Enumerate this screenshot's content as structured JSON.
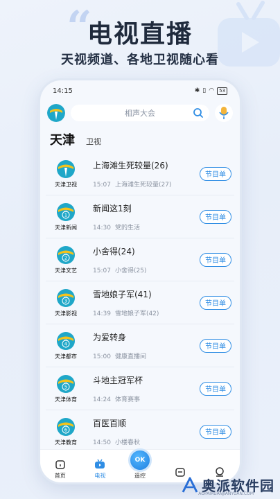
{
  "promo": {
    "title": "电视直播",
    "subtitle": "天视频道、各地卫视随心看"
  },
  "status_bar": {
    "time": "14:15",
    "icons": [
      "bluetooth-icon",
      "vibrate-icon",
      "wifi-icon",
      "battery-icon"
    ],
    "battery": "53"
  },
  "search": {
    "placeholder": "相声大会"
  },
  "categories": {
    "active": "天津",
    "secondary": "卫视"
  },
  "channels": [
    {
      "name": "天津卫视",
      "num": "",
      "now": "上海滩生死较量(26)",
      "next_time": "15:07",
      "next_title": "上海滩生死较量(27)",
      "button": "节目单"
    },
    {
      "name": "天津新闻",
      "num": "1",
      "now": "新闻这1刻",
      "next_time": "14:30",
      "next_title": "党的生活",
      "button": "节目单"
    },
    {
      "name": "天津文艺",
      "num": "2",
      "now": "小舍得(24)",
      "next_time": "15:07",
      "next_title": "小舍得(25)",
      "button": "节目单"
    },
    {
      "name": "天津影视",
      "num": "3",
      "now": "雪地娘子军(41)",
      "next_time": "14:39",
      "next_title": "雪地娘子军(42)",
      "button": "节目单"
    },
    {
      "name": "天津都市",
      "num": "4",
      "now": "为爱转身",
      "next_time": "15:00",
      "next_title": "健康直播间",
      "button": "节目单"
    },
    {
      "name": "天津体育",
      "num": "5",
      "now": "斗地主冠军杯",
      "next_time": "14:24",
      "next_title": "体育赛事",
      "button": "节目单"
    },
    {
      "name": "天津教育",
      "num": "6",
      "now": "百医百顺",
      "next_time": "14:50",
      "next_title": "小楼春秋",
      "button": "节目单"
    }
  ],
  "tabs": [
    {
      "label": "首页",
      "icon": "home-icon"
    },
    {
      "label": "电视",
      "icon": "tv-icon"
    },
    {
      "label": "遥控",
      "icon": "remote-icon",
      "ok": "OK"
    },
    {
      "label": "",
      "icon": "screen-icon"
    },
    {
      "label": "",
      "icon": "profile-icon"
    }
  ],
  "watermark": {
    "text": "奥派软件园",
    "url": "AOPAIRUANJIANYUAN.COM"
  },
  "colors": {
    "accent": "#2f8de4",
    "logo_teal": "#1fa7c8",
    "logo_yellow": "#f3c21b"
  }
}
